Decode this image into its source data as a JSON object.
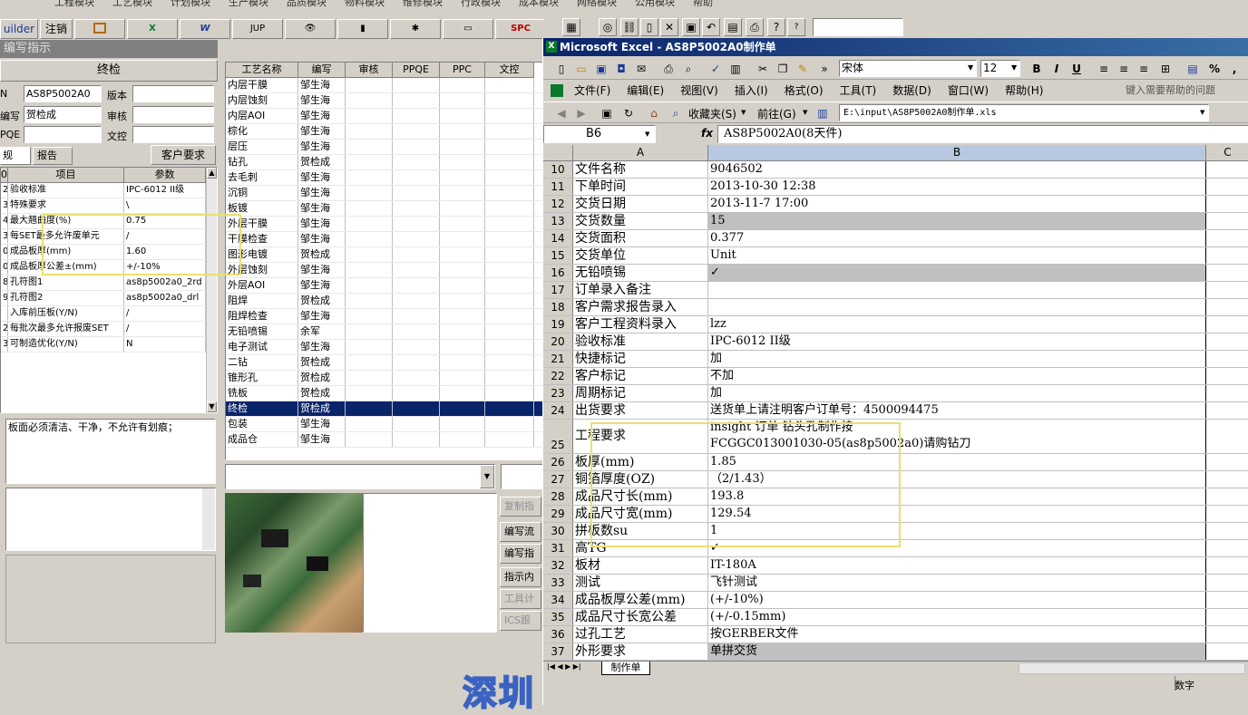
{
  "main_menu": [
    "工程模块",
    "工艺模块",
    "计划模块",
    "生产模块",
    "品质模块",
    "物料模块",
    "维修模块",
    "行政模块",
    "成本模块",
    "网络模块",
    "公用模块",
    "帮助"
  ],
  "toolbar": {
    "builder": "uilder",
    "logout": "注销",
    "jup": "JUP",
    "spc": "SPC"
  },
  "left_panel": {
    "title": "编写指示",
    "section": "终检",
    "pn_label": "N",
    "pn_value": "AS8P5002A0",
    "version_label": "版本",
    "author_label": "编写",
    "author_value": "贺检成",
    "review_label": "审核",
    "ppqe_label": "PQE",
    "docctrl_label": "文控",
    "tabs": [
      "规",
      "报告"
    ],
    "customer_req_btn": "客户要求",
    "param_headers": [
      "0",
      "项目",
      "参数"
    ]
  },
  "params": [
    {
      "no": "2",
      "item": "验收标准",
      "value": "IPC-6012 II级"
    },
    {
      "no": "3",
      "item": "特殊要求",
      "value": "\\"
    },
    {
      "no": "4",
      "item": "最大翘曲度(%)",
      "value": "0.75"
    },
    {
      "no": "3",
      "item": "每SET最多允许废单元",
      "value": "/"
    },
    {
      "no": "0",
      "item": "成品板厚(mm)",
      "value": "1.60"
    },
    {
      "no": "0",
      "item": "成品板厚公差±(mm)",
      "value": "+/-10%"
    },
    {
      "no": "8",
      "item": "孔符图1",
      "value": "as8p5002a0_2rd"
    },
    {
      "no": "9",
      "item": "孔符图2",
      "value": "as8p5002a0_drl"
    },
    {
      "no": "",
      "item": "入库前压板(Y/N)",
      "value": "/"
    },
    {
      "no": "2",
      "item": "每批次最多允许报废SET",
      "value": "/"
    },
    {
      "no": "3",
      "item": "可制造优化(Y/N)",
      "value": "N"
    }
  ],
  "note_text": "板面必须清洁、干净，不允许有划痕；",
  "process_headers": [
    "工艺名称",
    "编写",
    "审核",
    "PPQE",
    "PPC",
    "文控"
  ],
  "processes": [
    {
      "name": "内层干膜",
      "author": "邹生海"
    },
    {
      "name": "内层蚀刻",
      "author": "邹生海"
    },
    {
      "name": "内层AOI",
      "author": "邹生海"
    },
    {
      "name": "棕化",
      "author": "邹生海"
    },
    {
      "name": "层压",
      "author": "邹生海"
    },
    {
      "name": "钻孔",
      "author": "贺检成"
    },
    {
      "name": "去毛刺",
      "author": "邹生海"
    },
    {
      "name": "沉铜",
      "author": "邹生海"
    },
    {
      "name": "板镀",
      "author": "邹生海"
    },
    {
      "name": "外层干膜",
      "author": "邹生海"
    },
    {
      "name": "干膜检查",
      "author": "邹生海"
    },
    {
      "name": "图形电镀",
      "author": "贺检成"
    },
    {
      "name": "外层蚀刻",
      "author": "邹生海"
    },
    {
      "name": "外层AOI",
      "author": "邹生海"
    },
    {
      "name": "阻焊",
      "author": "贺检成"
    },
    {
      "name": "阻焊检查",
      "author": "邹生海"
    },
    {
      "name": "无铅喷锡",
      "author": "余军"
    },
    {
      "name": "电子测试",
      "author": "邹生海"
    },
    {
      "name": "二钻",
      "author": "贺检成"
    },
    {
      "name": "锥形孔",
      "author": "贺检成"
    },
    {
      "name": "铣板",
      "author": "贺检成"
    },
    {
      "name": "终检",
      "author": "贺检成"
    },
    {
      "name": "包装",
      "author": "邹生海"
    },
    {
      "name": "成品仓",
      "author": "邹生海"
    }
  ],
  "side_buttons": [
    "复制指",
    "编写流",
    "编写指",
    "指示内",
    "工具计",
    "ICS跟"
  ],
  "excel": {
    "title": "Microsoft Excel - AS8P5002A0制作单",
    "font": "宋体",
    "size": "12",
    "menu": [
      "文件(F)",
      "编辑(E)",
      "视图(V)",
      "插入(I)",
      "格式(O)",
      "工具(T)",
      "数据(D)",
      "窗口(W)",
      "帮助(H)"
    ],
    "help_prompt": "键入需要帮助的问题",
    "favorites": "收藏夹(S)",
    "goto": "前往(G)",
    "path": "E:\\input\\AS8P5002A0制作单.xls",
    "cell_ref": "B6",
    "fx": "fx",
    "formula": "AS8P5002A0(8天件)",
    "col_headers": [
      "A",
      "B",
      "C"
    ],
    "rows": [
      {
        "n": "10",
        "a": "文件名称",
        "b": "9046502"
      },
      {
        "n": "11",
        "a": "下单时间",
        "b": "2013-10-30 12:38"
      },
      {
        "n": "12",
        "a": "交货日期",
        "b": "2013-11-7 17:00"
      },
      {
        "n": "13",
        "a": "交货数量",
        "b": "15"
      },
      {
        "n": "14",
        "a": "交货面积",
        "b": "0.377"
      },
      {
        "n": "15",
        "a": "交货单位",
        "b": "Unit"
      },
      {
        "n": "16",
        "a": "无铅喷锡",
        "b": "✓"
      },
      {
        "n": "17",
        "a": "订单录入备注",
        "b": ""
      },
      {
        "n": "18",
        "a": "客户需求报告录入",
        "b": ""
      },
      {
        "n": "19",
        "a": "客户工程资料录入",
        "b": "lzz"
      },
      {
        "n": "20",
        "a": "验收标准",
        "b": "IPC-6012 II级"
      },
      {
        "n": "21",
        "a": "快捷标记",
        "b": "加"
      },
      {
        "n": "22",
        "a": "客户标记",
        "b": "不加"
      },
      {
        "n": "23",
        "a": "周期标记",
        "b": "加"
      },
      {
        "n": "24",
        "a": "出货要求",
        "b": "送货单上请注明客户订单号：4500094475"
      },
      {
        "n": "25",
        "a": "工程要求",
        "b": "insight 订单  钻头孔制作按",
        "b2": "FCGGC013001030-05(as8p5002a0)请购钻刀"
      },
      {
        "n": "26",
        "a": "板厚(mm)",
        "b": "1.85"
      },
      {
        "n": "27",
        "a": "铜箔厚度(OZ)",
        "b": "（2/1.43）"
      },
      {
        "n": "28",
        "a": "成品尺寸长(mm)",
        "b": "193.8"
      },
      {
        "n": "29",
        "a": "成品尺寸宽(mm)",
        "b": "129.54"
      },
      {
        "n": "30",
        "a": "拼板数su",
        "b": "1"
      },
      {
        "n": "31",
        "a": "高TG",
        "b": "✓"
      },
      {
        "n": "32",
        "a": "板材",
        "b": "IT-180A"
      },
      {
        "n": "33",
        "a": "测试",
        "b": "飞针测试"
      },
      {
        "n": "34",
        "a": "成品板厚公差(mm)",
        "b": "(+/-10%)"
      },
      {
        "n": "35",
        "a": "成品尺寸长宽公差",
        "b": "(+/-0.15mm)"
      },
      {
        "n": "36",
        "a": "过孔工艺",
        "b": "按GERBER文件"
      },
      {
        "n": "37",
        "a": "外形要求",
        "b": "单拼交货"
      }
    ],
    "sheet_tab": "制作单",
    "status_num": "数字"
  },
  "watermark": "深圳"
}
